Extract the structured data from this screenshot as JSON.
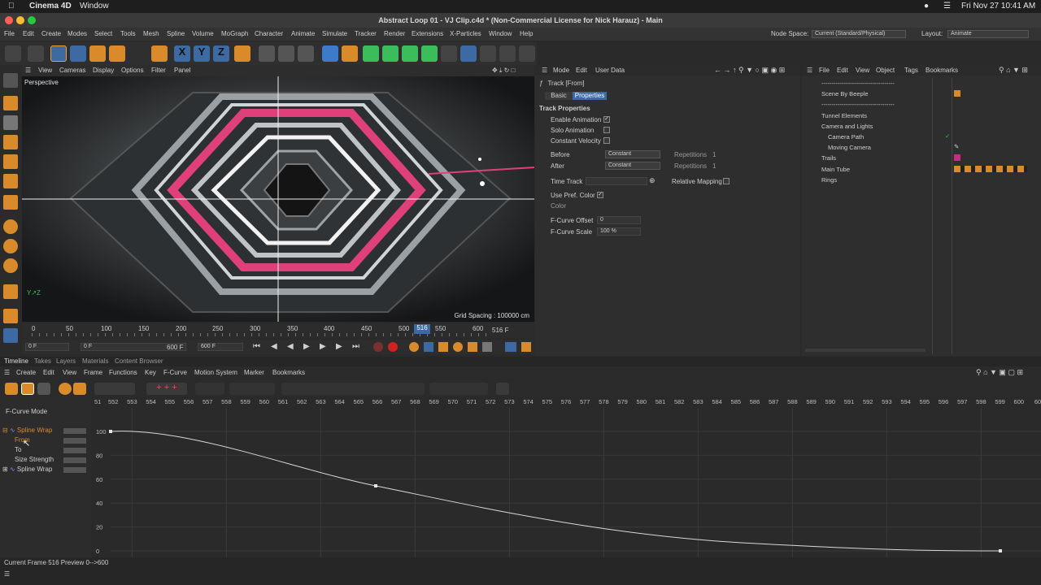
{
  "mac": {
    "app": "Cinema 4D",
    "window_menu": "Window",
    "datetime": "Fri Nov 27  10:41 AM"
  },
  "window": {
    "title": "Abstract Loop 01 - VJ Clip.c4d * (Non-Commercial License for Nick Harauz) - Main"
  },
  "menu": {
    "items": [
      "File",
      "Edit",
      "Create",
      "Modes",
      "Select",
      "Tools",
      "Mesh",
      "Spline",
      "Volume",
      "MoGraph",
      "Character",
      "Animate",
      "Simulate",
      "Tracker",
      "Render",
      "Extensions",
      "X-Particles",
      "Window",
      "Help"
    ],
    "node_space_label": "Node Space:",
    "node_space_value": "Current (Standard/Physical)",
    "layout_label": "Layout:",
    "layout_value": "Animate"
  },
  "viewport": {
    "menu": [
      "View",
      "Cameras",
      "Display",
      "Options",
      "Filter",
      "Panel"
    ],
    "label": "Perspective",
    "grid_spacing": "Grid Spacing : 100000 cm",
    "ruler_ticks": [
      "0",
      "50",
      "100",
      "150",
      "200",
      "250",
      "300",
      "350",
      "400",
      "450",
      "500",
      "550",
      "600"
    ],
    "playhead": "516",
    "frame_display": "516 F",
    "current_frame": "0 F",
    "range_start": "0 F",
    "range_end": "600 F",
    "max_frame": "600 F"
  },
  "attributes": {
    "menu": [
      "Mode",
      "Edit",
      "User Data"
    ],
    "track_title": "Track [From]",
    "tabs": [
      "Basic",
      "Properties"
    ],
    "section": "Track Properties",
    "enable_animation": "Enable Animation",
    "solo_animation": "Solo Animation",
    "constant_velocity": "Constant Velocity",
    "before_label": "Before",
    "before_value": "Constant",
    "after_label": "After",
    "after_value": "Constant",
    "repetitions_label": "Repetitions",
    "repetitions_value": "1",
    "time_track": "Time Track",
    "relative_mapping": "Relative Mapping",
    "use_pref_color": "Use Pref. Color",
    "color_label": "Color",
    "fcurve_offset_label": "F-Curve Offset",
    "fcurve_offset_value": "0",
    "fcurve_scale_label": "F-Curve Scale",
    "fcurve_scale_value": "100 %"
  },
  "objects": {
    "menu": [
      "File",
      "Edit",
      "View",
      "Object",
      "Tags",
      "Bookmarks"
    ],
    "rows": [
      {
        "name": "------------------------------------",
        "indent": 0
      },
      {
        "name": "Scene By Beeple",
        "indent": 0
      },
      {
        "name": "------------------------------------",
        "indent": 0
      },
      {
        "name": "Tunnel Elements",
        "indent": 0
      },
      {
        "name": "Camera and Lights",
        "indent": 0
      },
      {
        "name": "Camera Path",
        "indent": 1
      },
      {
        "name": "Moving Camera",
        "indent": 1
      },
      {
        "name": "Trails",
        "indent": 0
      },
      {
        "name": "Main Tube",
        "indent": 0
      },
      {
        "name": "Rings",
        "indent": 0
      }
    ]
  },
  "timeline": {
    "tabs": [
      "Timeline",
      "Takes",
      "Layers",
      "Materials",
      "Content Browser"
    ],
    "menu": [
      "Create",
      "Edit",
      "View",
      "Frame",
      "Functions",
      "Key",
      "F-Curve",
      "Motion System",
      "Marker",
      "Bookmarks"
    ],
    "mode_label": "F-Curve Mode",
    "frame_ticks": [
      "51",
      "552",
      "553",
      "554",
      "555",
      "556",
      "557",
      "558",
      "559",
      "560",
      "561",
      "562",
      "563",
      "564",
      "565",
      "566",
      "567",
      "568",
      "569",
      "570",
      "571",
      "572",
      "573",
      "574",
      "575",
      "576",
      "577",
      "578",
      "579",
      "580",
      "581",
      "582",
      "583",
      "584",
      "585",
      "586",
      "587",
      "588",
      "589",
      "590",
      "591",
      "592",
      "593",
      "594",
      "595",
      "596",
      "597",
      "598",
      "599",
      "600",
      "60"
    ],
    "tracks": [
      {
        "name": "Spline Wrap",
        "level": 0
      },
      {
        "name": "From",
        "level": 1
      },
      {
        "name": "To",
        "level": 1
      },
      {
        "name": "Size Strength",
        "level": 1
      },
      {
        "name": "Spline Wrap",
        "level": 0
      }
    ],
    "y_ticks": [
      "100",
      "80",
      "60",
      "40",
      "20",
      "0"
    ],
    "status": "Current Frame  516  Preview  0-->600"
  },
  "colors": {
    "accent": "#3d6aa3",
    "pink": "#e0407a",
    "curve": "#c8c8c8",
    "orange": "#d98a2b"
  }
}
